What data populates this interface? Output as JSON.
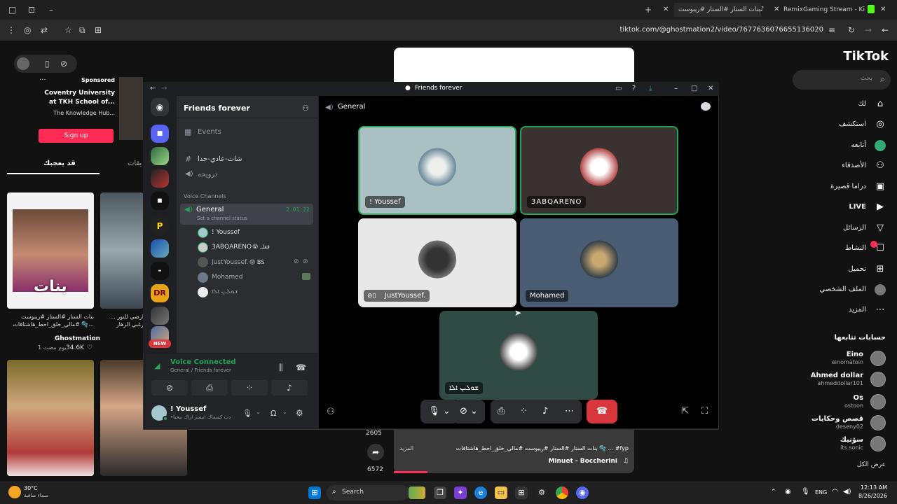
{
  "browser": {
    "tabs": [
      {
        "label": "بنات الستار #الستار #ريبوست ..."
      },
      {
        "label": "RemixGaming Stream - Kick De..."
      }
    ],
    "url": "tiktok.com/@ghostmation2/video/7677636076655136020"
  },
  "tiktok": {
    "logo": "TikTok",
    "search_placeholder": "بحث",
    "nav": [
      {
        "label": "لك",
        "icon": "home-icon"
      },
      {
        "label": "استكشف",
        "icon": "compass-icon"
      },
      {
        "label": "أتابعه",
        "icon": "following-icon"
      },
      {
        "label": "الأصدقاء",
        "icon": "friends-icon"
      },
      {
        "label": "دراما قصيرة",
        "icon": "drama-icon"
      },
      {
        "label": "LIVE",
        "icon": "live-icon"
      },
      {
        "label": "الرسائل",
        "icon": "messages-icon"
      },
      {
        "label": "النشاط",
        "icon": "activity-icon"
      },
      {
        "label": "تحميل",
        "icon": "upload-icon"
      },
      {
        "label": "الملف الشخصي",
        "icon": "profile-icon"
      },
      {
        "label": "المزيد",
        "icon": "more-icon"
      }
    ],
    "following_header": "حسابات تتابعها",
    "following": [
      {
        "name": "Eino",
        "handle": "einomatoin"
      },
      {
        "name": "Ahmed dollar",
        "handle": "ahmeddollar101"
      },
      {
        "name": "Os",
        "handle": "ostoon"
      },
      {
        "name": "قصص وحكايات",
        "handle": "deseny02"
      },
      {
        "name": "سۆنیك",
        "handle": "its.sonic"
      }
    ],
    "show_all": "عرض الكل",
    "sponsored": {
      "label": "Sponsored",
      "title": "Coventry University at TKH School of...",
      "sub": "The Knowledge Hub...",
      "button": "Sign up"
    },
    "tabs": [
      {
        "label": "قد يعجبك"
      },
      {
        "label": "يقات"
      }
    ],
    "video_card": {
      "caption": "بنات الستار #الستار #ريبوست #مالي_خلق_احط_هاشتاقات 🫧...",
      "author": "Ghostmation",
      "likes": "34.6K",
      "age": "1 يوم مضت",
      "overlay_text": "بنات"
    },
    "video_card2": {
      "caption": "ارضي للنور ... رغبي الزهار"
    },
    "player": {
      "share_count": "2605",
      "more_count": "6572",
      "caption": "بنات الستار #الستار #ريبوست #مالي_خلق_احط_هاشتاقات 🫧 ... #fyp",
      "more": "المزيد",
      "music": "Minuet - Boccherini"
    }
  },
  "discord": {
    "window_title": "Friends forever",
    "server_name": "Friends forever",
    "events": "Events",
    "text_channel": "شات-عادي-جدا",
    "voice_channel_extra": "ترويحه",
    "voice_section": "Voice Channels",
    "general": "General",
    "timer": "2:01:22",
    "status_hint": "Set a channel status",
    "voice_users": [
      {
        "name": "! Youssef",
        "badge": ""
      },
      {
        "name": "3ABQARENO",
        "badge": "😵 قفل"
      },
      {
        "name": "JustYoussef.",
        "badge": "😝 BS"
      },
      {
        "name": "Mohamed",
        "badge": ""
      },
      {
        "name": "ܫܘܠܝܢ ܐܠܐ",
        "badge": ""
      }
    ],
    "new_badge": "NEW",
    "voice_connected": "Voice Connected",
    "voice_sub": "General / Friends forever",
    "user_name": "! Youssef",
    "user_status": "•دت كسماك انيسر اراك بيحبا",
    "stage_title": "General",
    "tiles": [
      {
        "name": "! Youssef"
      },
      {
        "name": "3ABQARENO"
      },
      {
        "name": "JustYoussef."
      },
      {
        "name": "Mohamed"
      },
      {
        "name": "ܫܘܠܝܢ ܐܠܐ"
      }
    ],
    "colors": {
      "speaking": "#23a55a",
      "blurple": "#5865f2",
      "hangup": "#da373c"
    }
  },
  "taskbar": {
    "weather_temp": "30°C",
    "weather_desc": "سماء صافية",
    "search": "Search",
    "lang": "ENG",
    "time": "12:13 AM",
    "date": "8/26/2026"
  }
}
